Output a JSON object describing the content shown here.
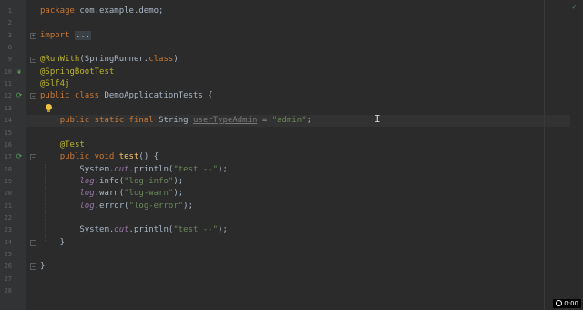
{
  "editor": {
    "line_numbers": [
      "1",
      "2",
      "3",
      "",
      "",
      "",
      "",
      "",
      "",
      "",
      "",
      "",
      "",
      "",
      "",
      "",
      "",
      "",
      "",
      "",
      "",
      "",
      "",
      "",
      "",
      "",
      "",
      ""
    ],
    "lines": [
      {
        "n": "1",
        "parts": [
          [
            "kw",
            "package "
          ],
          [
            "plain",
            "com.example.demo"
          ],
          [
            "plain",
            ";"
          ]
        ]
      },
      {
        "n": "2",
        "parts": []
      },
      {
        "n": "3",
        "parts": [
          [
            "kw",
            "import "
          ],
          [
            "plain",
            "..."
          ]
        ]
      },
      {
        "n": "",
        "parts": []
      },
      {
        "n": "",
        "parts": []
      },
      {
        "n": "",
        "parts": [
          [
            "ann",
            "@RunWith"
          ],
          [
            "plain",
            "(SpringRunner."
          ],
          [
            "kw",
            "class"
          ],
          [
            "plain",
            ")"
          ]
        ]
      }
    ],
    "gutter_numbers": [
      "1",
      "2",
      "3",
      "8",
      "9",
      "10",
      "11",
      "12",
      "13",
      "14",
      "15",
      "16",
      "17",
      "18",
      "19",
      "20",
      "21",
      "22",
      "23",
      "24",
      "25",
      "26",
      "27",
      "28"
    ],
    "code": [
      [
        [
          "kw",
          "package "
        ],
        [
          "plain",
          "com.example.demo;"
        ]
      ],
      [],
      [
        [
          "kw",
          "import "
        ],
        [
          "fold",
          "..."
        ]
      ],
      [],
      [
        [
          "ann",
          "@RunWith"
        ],
        [
          "plain",
          "(SpringRunner."
        ],
        [
          "kw",
          "class"
        ],
        [
          "plain",
          ")"
        ]
      ],
      [
        [
          "ann",
          "@SpringBootTest"
        ]
      ],
      [
        [
          "ann",
          "@Slf4j"
        ]
      ],
      [
        [
          "kw",
          "public class "
        ],
        [
          "plain",
          "DemoApplicationTests {"
        ]
      ],
      [],
      [
        [
          "plain",
          "    "
        ],
        [
          "kw",
          "public static final "
        ],
        [
          "plain",
          "String "
        ],
        [
          "mut",
          "userTypeAdmin"
        ],
        [
          "plain",
          " = "
        ],
        [
          "str",
          "\"admin\""
        ],
        [
          "plain",
          ";"
        ]
      ],
      [],
      [
        [
          "plain",
          "    "
        ],
        [
          "ann",
          "@Test"
        ]
      ],
      [
        [
          "plain",
          "    "
        ],
        [
          "kw",
          "public void "
        ],
        [
          "fn",
          "test"
        ],
        [
          "plain",
          "() {"
        ]
      ],
      [
        [
          "plain",
          "        System."
        ],
        [
          "stat",
          "out"
        ],
        [
          "plain",
          ".println("
        ],
        [
          "str",
          "\"test --\""
        ],
        [
          "plain",
          ");"
        ]
      ],
      [
        [
          "plain",
          "        "
        ],
        [
          "stat",
          "log"
        ],
        [
          "plain",
          ".info("
        ],
        [
          "str",
          "\"log-info\""
        ],
        [
          "plain",
          ");"
        ]
      ],
      [
        [
          "plain",
          "        "
        ],
        [
          "stat",
          "log"
        ],
        [
          "plain",
          ".warn("
        ],
        [
          "str",
          "\"log-warn\""
        ],
        [
          "plain",
          ");"
        ]
      ],
      [
        [
          "plain",
          "        "
        ],
        [
          "stat",
          "log"
        ],
        [
          "plain",
          ".error("
        ],
        [
          "str",
          "\"log-error\""
        ],
        [
          "plain",
          ");"
        ]
      ],
      [],
      [
        [
          "plain",
          "        System."
        ],
        [
          "stat",
          "out"
        ],
        [
          "plain",
          ".println("
        ],
        [
          "str",
          "\"test --\""
        ],
        [
          "plain",
          ");"
        ]
      ],
      [
        [
          "plain",
          "    }"
        ]
      ],
      [],
      [
        [
          "plain",
          "}"
        ]
      ],
      [],
      []
    ]
  },
  "timer": "0:00",
  "colors": {
    "background": "#2b2b2b",
    "gutter": "#313335",
    "keyword": "#cc7832",
    "annotation": "#bbb529",
    "string": "#6a8759",
    "static_field": "#9876aa",
    "method": "#ffc66d",
    "text": "#a9b7c6"
  },
  "icons": {
    "spring_bean": "spring-leaf-icon",
    "run_test": "run-test-icon",
    "intention": "lightbulb-icon"
  }
}
